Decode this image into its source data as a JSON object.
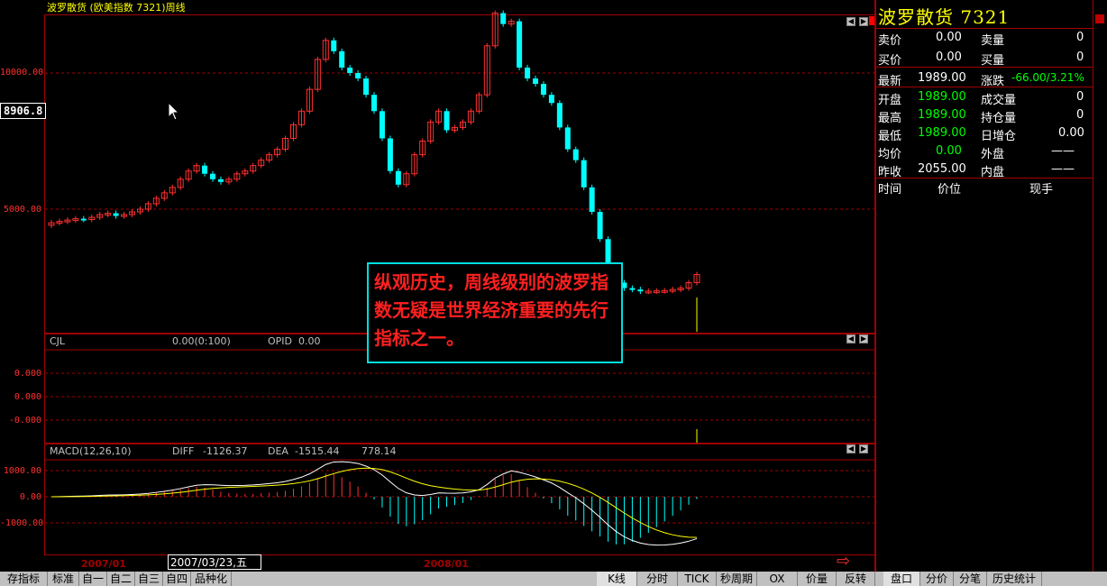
{
  "chart_title": "波罗散货 (欧美指数 7321)周线",
  "cursor_price": "8906.8",
  "price_axis": [
    "10000.00",
    "5000.00"
  ],
  "cjl_panel": {
    "name": "CJL",
    "value": "0.00(0:100)",
    "opid_label": "OPID",
    "opid_value": "0.00"
  },
  "cjl_axis": [
    "0.000",
    "0.000",
    "-0.000"
  ],
  "macd_panel": {
    "name": "MACD(12,26,10)",
    "diff_label": "DIFF",
    "diff_value": "-1126.37",
    "dea_label": "DEA",
    "dea_value": "-1515.44",
    "macd_value": "778.14"
  },
  "macd_axis": [
    "1000.00",
    "0.00",
    "-1000.00"
  ],
  "date_labels": {
    "left": "2007/01",
    "cursor": "2007/03/23,五",
    "right": "2008/01"
  },
  "annotation": "纵观历史，周线级别的波罗指数无疑是世界经济重要的先行指标之一。",
  "quote": {
    "title": "波罗散货 7321",
    "sell_price_label": "卖价",
    "sell_price": "0.00",
    "sell_vol_label": "卖量",
    "sell_vol": "0",
    "buy_price_label": "买价",
    "buy_price": "0.00",
    "buy_vol_label": "买量",
    "buy_vol": "0",
    "latest_label": "最新",
    "latest": "1989.00",
    "change_label": "涨跌",
    "change": "-66.00/3.21%",
    "open_label": "开盘",
    "open": "1989.00",
    "volume_label": "成交量",
    "volume": "0",
    "high_label": "最高",
    "high": "1989.00",
    "oi_label": "持仓量",
    "oi": "0",
    "low_label": "最低",
    "low": "1989.00",
    "day_inc_label": "日增仓",
    "day_inc": "0.00",
    "avg_label": "均价",
    "avg": "0.00",
    "outer_label": "外盘",
    "outer": "——",
    "prev_close_label": "昨收",
    "prev_close": "2055.00",
    "inner_label": "内盘",
    "inner": "——",
    "trades_header": {
      "time": "时间",
      "price": "价位",
      "vol": "现手"
    }
  },
  "bottom_tabs_left": [
    "存指标",
    "标准",
    "自一",
    "自二",
    "自三",
    "自四",
    "品种化"
  ],
  "bottom_tabs_mid": [
    "K线",
    "分时",
    "TICK",
    "秒周期",
    "OX",
    "价量",
    "反转"
  ],
  "bottom_tabs_right": [
    "盘口",
    "分价",
    "分笔",
    "历史统计"
  ],
  "colors": {
    "up": "#ff3030",
    "down": "#00ffff",
    "grid": "#a00000",
    "diff_line": "#ffffff",
    "dea_line": "#ffff00"
  },
  "chart_data": {
    "type": "candlestick",
    "period": "weekly",
    "closes": [
      4500,
      4550,
      4600,
      4650,
      4620,
      4700,
      4800,
      4850,
      4750,
      4800,
      4900,
      5000,
      5200,
      5400,
      5600,
      5800,
      6100,
      6400,
      6600,
      6300,
      6100,
      6000,
      6100,
      6300,
      6400,
      6600,
      6800,
      7000,
      7200,
      7600,
      8100,
      8600,
      9400,
      10500,
      11200,
      10800,
      10200,
      10000,
      9800,
      9200,
      8600,
      7600,
      6400,
      5900,
      6300,
      7000,
      7500,
      8200,
      8600,
      7900,
      8000,
      8200,
      8600,
      9200,
      11000,
      12200,
      11800,
      11900,
      10200,
      9800,
      9600,
      9200,
      8900,
      8000,
      7200,
      6800,
      5800,
      4900,
      3900,
      2800,
      2300,
      2100,
      2050,
      1980,
      1990,
      2000,
      2010,
      2050,
      2100,
      2300,
      2600
    ],
    "macd": {
      "diff": -1126.37,
      "dea": -1515.44,
      "macd": 778.14
    },
    "y_axis_ticks": [
      5000,
      10000
    ]
  }
}
